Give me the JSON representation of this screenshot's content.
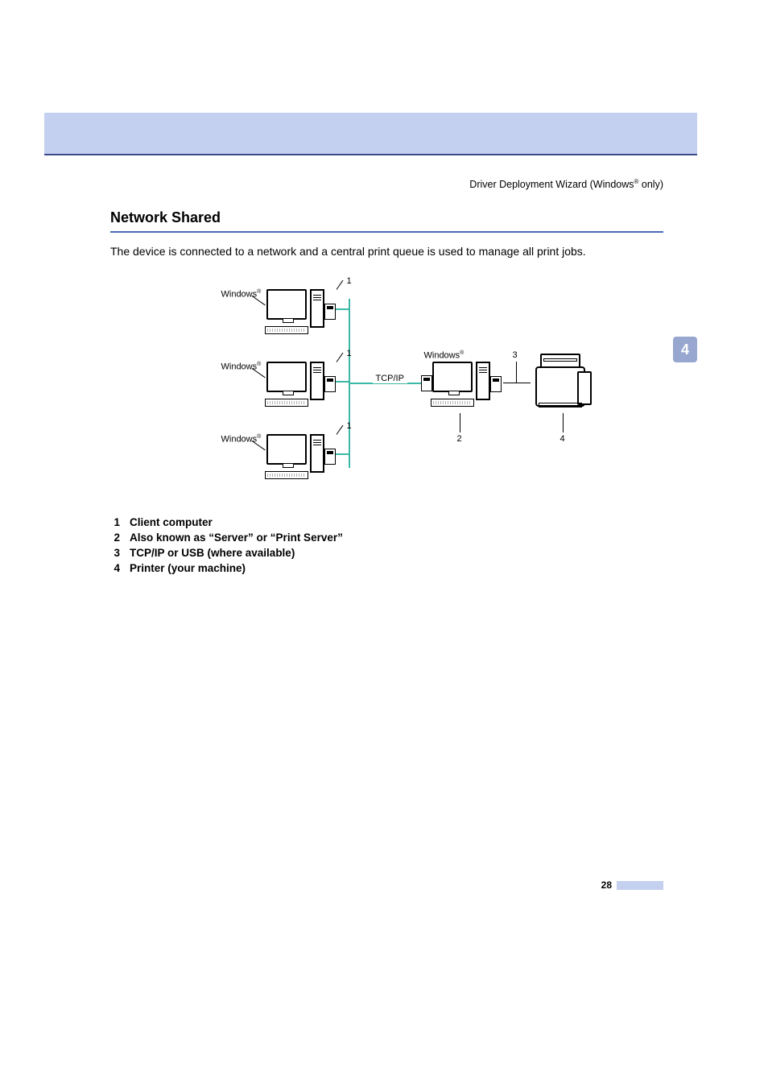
{
  "header": {
    "breadcrumb_prefix": "Driver Deployment Wizard (Windows",
    "breadcrumb_suffix": " only)"
  },
  "section": {
    "heading": "Network Shared",
    "body": "The device is connected to a network and a central print queue is used to manage all print jobs."
  },
  "diagram": {
    "os_label": "Windows",
    "tcpip": "TCP/IP",
    "callouts": {
      "n1": "1",
      "n2": "2",
      "n3": "3",
      "n4": "4"
    }
  },
  "legend": {
    "items": [
      {
        "num": "1",
        "text": "Client computer"
      },
      {
        "num": "2",
        "text": "Also known as “Server” or “Print Server”"
      },
      {
        "num": "3",
        "text": "TCP/IP or USB (where available)"
      },
      {
        "num": "4",
        "text": "Printer (your machine)"
      }
    ]
  },
  "side_tab": "4",
  "footer": {
    "page": "28"
  }
}
